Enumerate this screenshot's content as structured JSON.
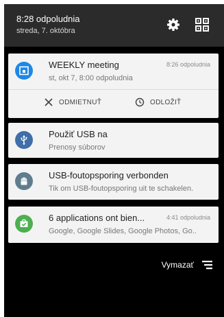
{
  "status": {
    "time": "8:28 odpoludnia",
    "date": "streda, 7. októbra"
  },
  "notifications": [
    {
      "title": "WEEKLY meeting",
      "timestamp": "8:26 odpoludnia",
      "subtitle": "st, okt 7, 8:00 odpoludnia",
      "icon": "calendar-icon",
      "color": "#1e88e5",
      "actions": [
        {
          "label": "ODMIETNUŤ",
          "icon": "close-icon"
        },
        {
          "label": "ODLOŽIŤ",
          "icon": "clock-icon"
        }
      ]
    },
    {
      "title": "Použiť USB na",
      "subtitle": "Prenosy súborov",
      "icon": "usb-icon",
      "color": "#3f6ea9"
    },
    {
      "title": "USB-foutopsporing verbonden",
      "subtitle": "Tik om USB-foutopsporing uit te schakelen.",
      "icon": "android-debug-icon",
      "color": "#5f7d8c"
    },
    {
      "title": "6 applications ont bien...",
      "timestamp": "4:41 odpoludnia",
      "subtitle": "Google, Google Slides, Google Photos, Go..",
      "icon": "play-store-icon",
      "color": "#4caf50"
    }
  ],
  "clear_all": {
    "label": "Vymazať",
    "icon": "clear-all-icon"
  }
}
